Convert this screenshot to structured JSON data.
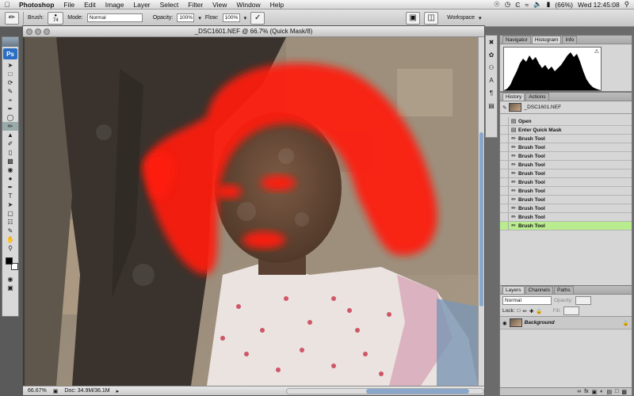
{
  "menubar": {
    "app_name": "Photoshop",
    "items": [
      "File",
      "Edit",
      "Image",
      "Layer",
      "Select",
      "Filter",
      "View",
      "Window",
      "Help"
    ],
    "battery": "(66%)",
    "clock": "Wed 12:45:08"
  },
  "options": {
    "brush_label": "Brush:",
    "brush_size": "74",
    "mode_label": "Mode:",
    "mode_value": "Normal",
    "opacity_label": "Opacity:",
    "opacity_value": "100%",
    "flow_label": "Flow:",
    "flow_value": "100%",
    "workspace_label": "Workspace"
  },
  "toolbox": {
    "logo": "Ps",
    "foreground_color": "#000000",
    "background_color": "#ffffff"
  },
  "document": {
    "title": "_DSC1601.NEF @ 66.7% (Quick Mask/8)",
    "zoom": "66.67%",
    "doc_size": "Doc: 34.9M/36.1M",
    "mask_color": "#ff1a10"
  },
  "navigator_panel": {
    "tabs": [
      "Navigator",
      "Histogram",
      "Info"
    ],
    "active_tab": "Histogram"
  },
  "history_panel": {
    "tabs": [
      "History",
      "Actions"
    ],
    "snapshot": "_DSC1601.NEF",
    "states": [
      "Open",
      "Enter Quick Mask",
      "Brush Tool",
      "Brush Tool",
      "Brush Tool",
      "Brush Tool",
      "Brush Tool",
      "Brush Tool",
      "Brush Tool",
      "Brush Tool",
      "Brush Tool",
      "Brush Tool",
      "Brush Tool"
    ],
    "selected_index": 12,
    "selected_color": "#b9ec8e"
  },
  "layers_panel": {
    "tabs": [
      "Layers",
      "Channels",
      "Paths"
    ],
    "blend_mode": "Normal",
    "opacity_label": "Opacity:",
    "lock_label": "Lock:",
    "fill_label": "Fill:",
    "layer_name": "Background"
  }
}
